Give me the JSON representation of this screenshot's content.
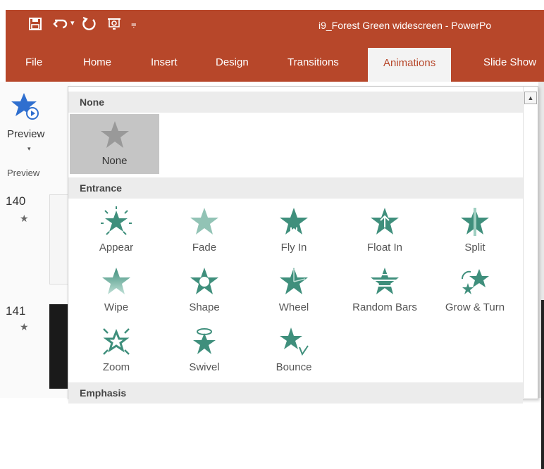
{
  "window": {
    "title": "i9_Forest Green widescreen  -  PowerPo"
  },
  "quick_access": {
    "icons": [
      "save-icon",
      "undo-icon",
      "redo-icon",
      "presentation-icon",
      "customize-qat-icon"
    ],
    "undo_dropdown": "▾",
    "customize_glyph": "⩦"
  },
  "tabs": [
    "File",
    "Home",
    "Insert",
    "Design",
    "Transitions",
    "Animations",
    "Slide Show"
  ],
  "active_tab": "Animations",
  "ribbon": {
    "preview_label": "Preview",
    "preview_caret": "▾",
    "preview_group": "Preview"
  },
  "slides": [
    {
      "number": "140",
      "marker": "★"
    },
    {
      "number": "141",
      "marker": "★"
    }
  ],
  "gallery": {
    "sections": {
      "none": "None",
      "entrance": "Entrance",
      "emphasis": "Emphasis"
    },
    "none_item": "None",
    "entrance_items": [
      "Appear",
      "Fade",
      "Fly In",
      "Float In",
      "Split",
      "Wipe",
      "Shape",
      "Wheel",
      "Random Bars",
      "Grow & Turn",
      "Zoom",
      "Swivel",
      "Bounce"
    ],
    "scroll_up": "▲"
  },
  "colors": {
    "brand": "#b7472a",
    "tab_active_text": "#b7472a",
    "star_green": "#3f8f7c",
    "star_light": "#9fcfc1",
    "none_tile": "#c5c5c5",
    "preview_star": "#2f6fcf"
  }
}
